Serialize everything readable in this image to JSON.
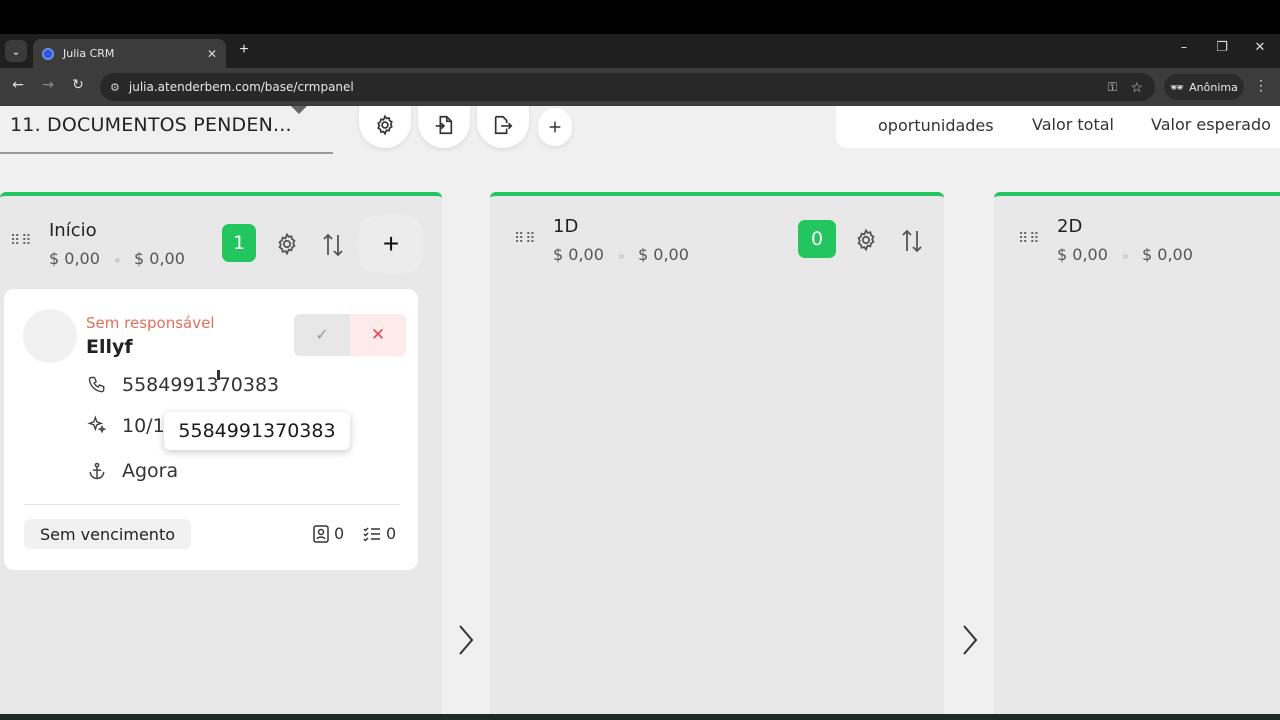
{
  "browser": {
    "tab_title": "Julia CRM",
    "url": "julia.atenderbem.com/base/crmpanel",
    "profile_label": "Anônima"
  },
  "toolbar": {
    "pipeline_name": "11. DOCUMENTOS PENDEN..."
  },
  "summary": {
    "opportunities_label": "oportunidades",
    "total_label": "Valor total",
    "expected_label": "Valor esperado"
  },
  "columns": [
    {
      "name": "Início",
      "total": "$ 0,00",
      "expected": "$ 0,00",
      "count": "1"
    },
    {
      "name": "1D",
      "total": "$ 0,00",
      "expected": "$ 0,00",
      "count": "0"
    },
    {
      "name": "2D",
      "total": "$ 0,00",
      "expected": "$ 0,00"
    }
  ],
  "card": {
    "owner": "Sem responsável",
    "name": "Ellyf",
    "phone": "5584991370383",
    "date": "10/12",
    "time": "Agora",
    "due": "Sem vencimento",
    "contacts_count": "0",
    "tasks_count": "0"
  },
  "tooltip": {
    "text": "5584991370383"
  },
  "colors": {
    "accent": "#22c55e",
    "owner_warning": "#e0705a",
    "reject": "#e0485e"
  }
}
